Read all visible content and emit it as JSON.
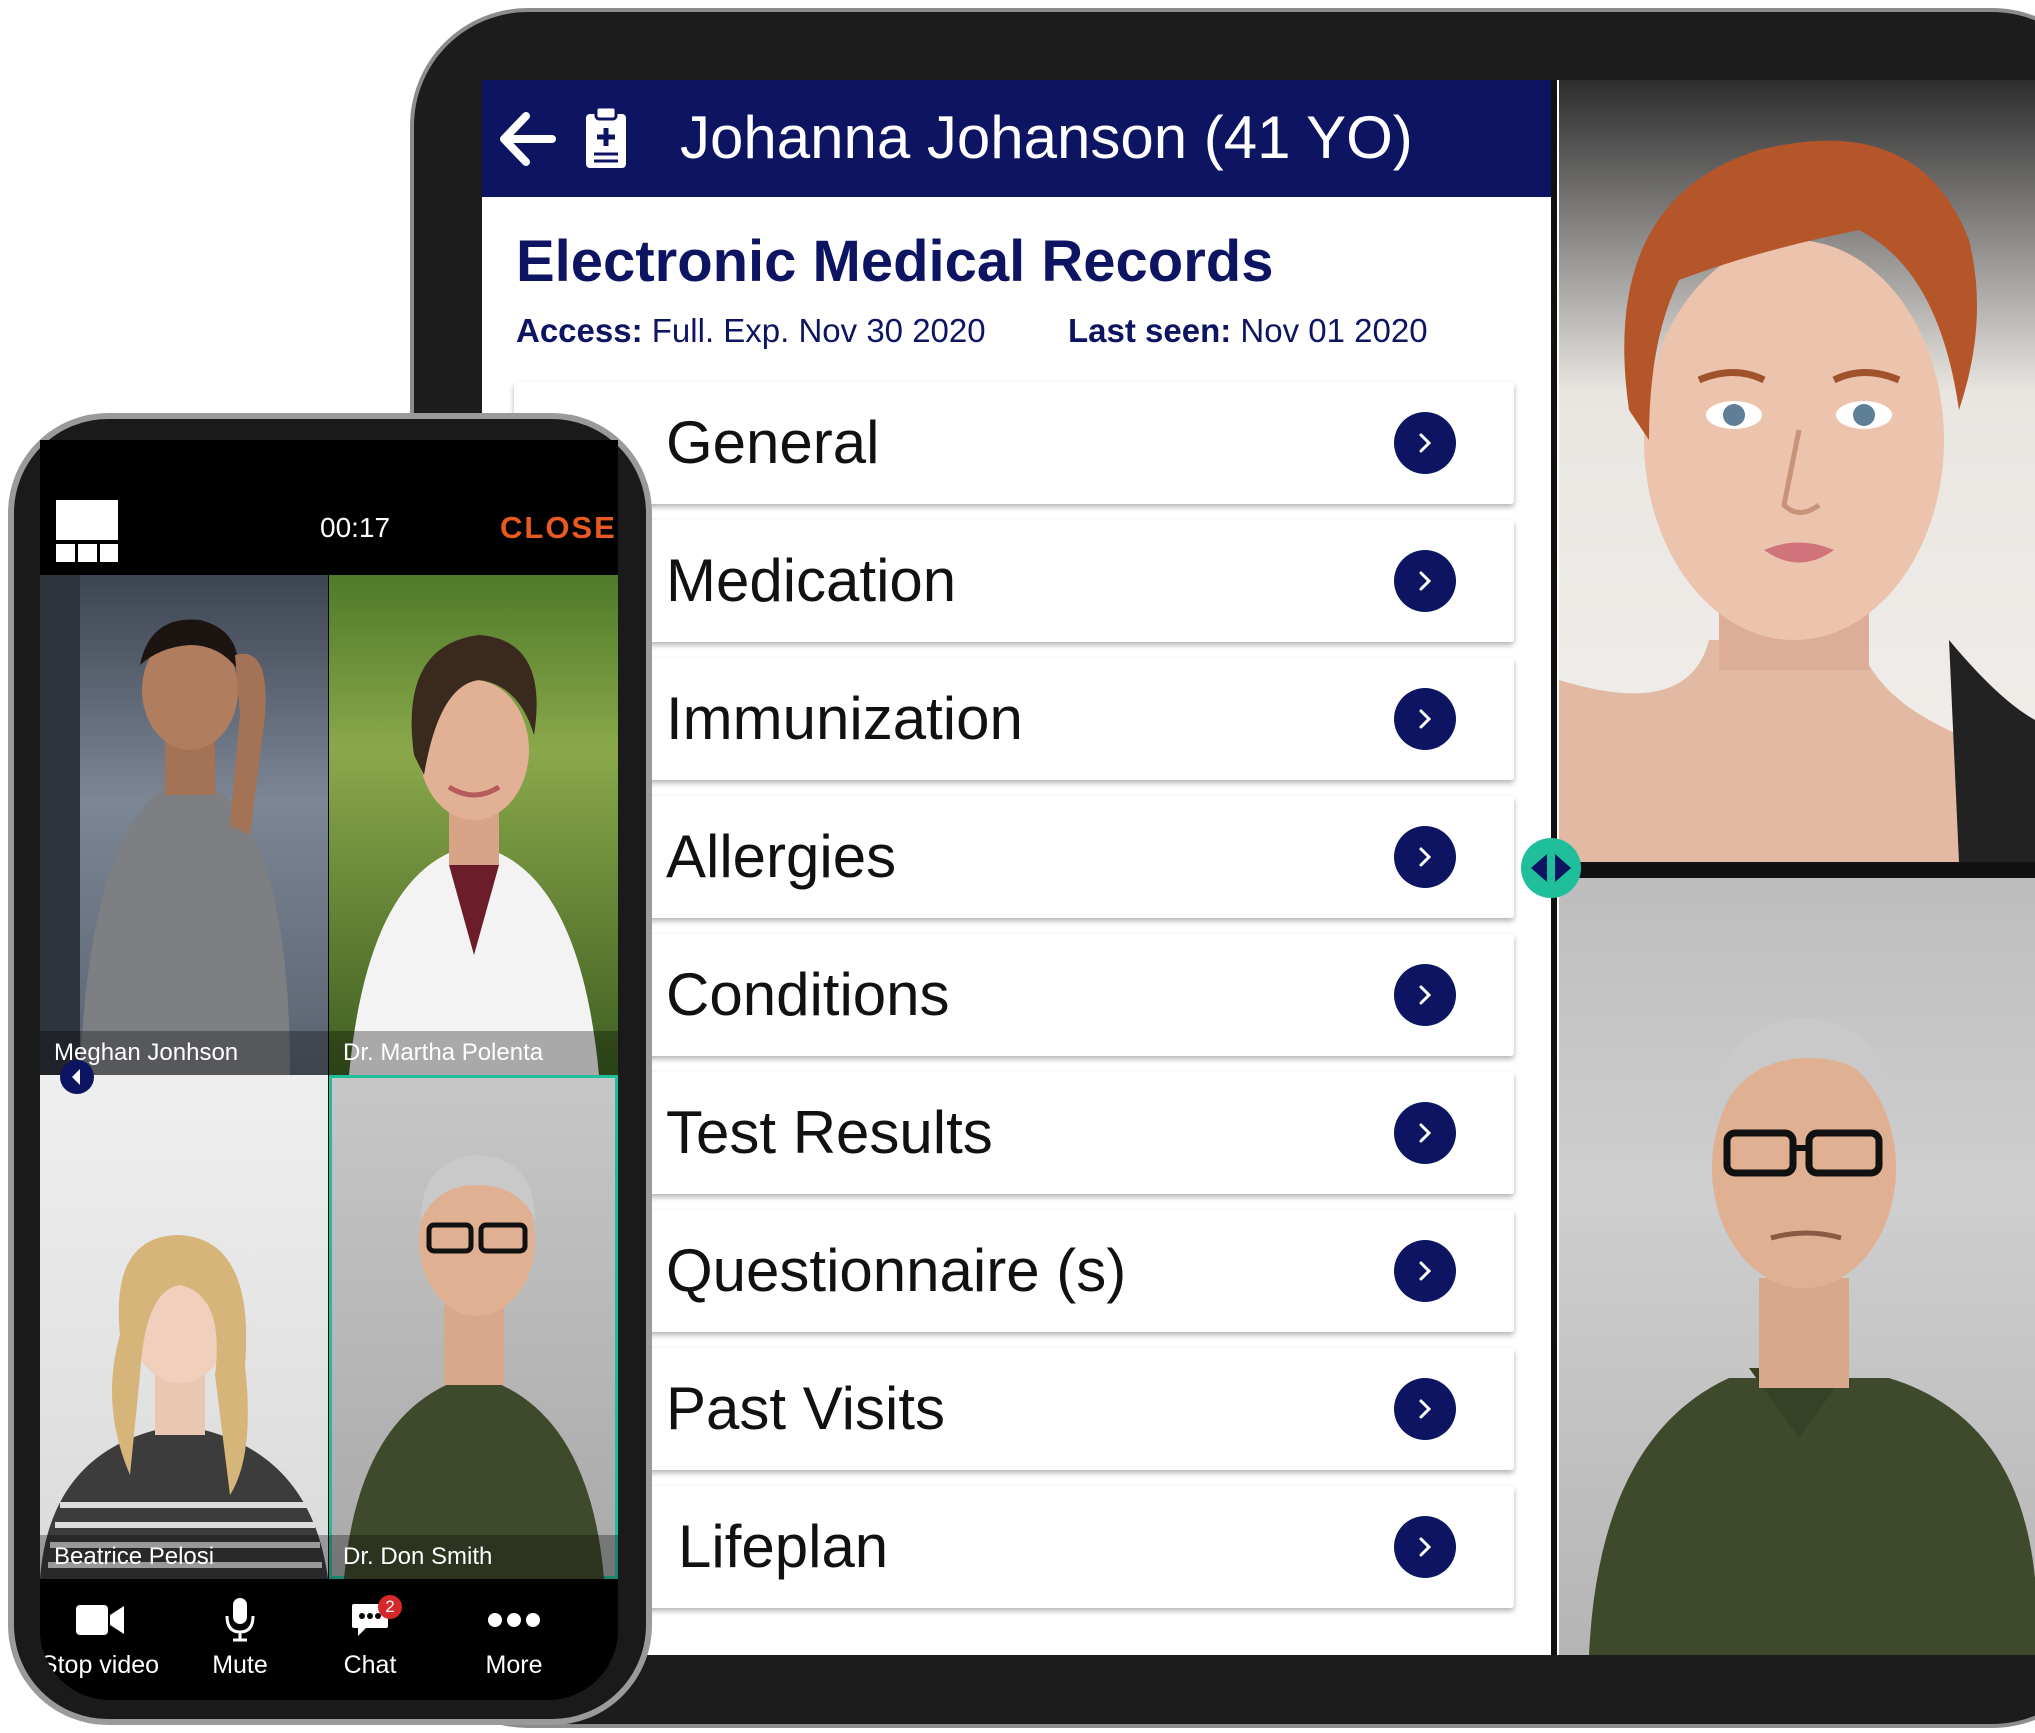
{
  "emr": {
    "patient_name": "Johanna Johanson (41 YO)",
    "title": "Electronic Medical Records",
    "access_label": "Access:",
    "access_value": "Full. Exp. Nov 30 2020",
    "last_seen_label": "Last seen:",
    "last_seen_value": "Nov 01 2020",
    "sections": [
      {
        "label": "General"
      },
      {
        "label": "Medication"
      },
      {
        "label": "Immunization"
      },
      {
        "label": "Allergies"
      },
      {
        "label": "Conditions"
      },
      {
        "label": "Test Results"
      },
      {
        "label": "Questionnaire (s)"
      },
      {
        "label": "Past Visits"
      },
      {
        "label": "Lifeplan"
      }
    ]
  },
  "call": {
    "timer": "00:17",
    "close_label": "CLOSE",
    "participants": [
      {
        "name": "Meghan  Jonhson"
      },
      {
        "name": "Dr. Martha Polenta"
      },
      {
        "name": "Beatrice Pelosi"
      },
      {
        "name": "Dr. Don Smith"
      }
    ],
    "toolbar": {
      "stop_video": "Stop video",
      "mute": "Mute",
      "chat": "Chat",
      "chat_badge": "2",
      "more": "More"
    }
  },
  "colors": {
    "navy": "#0d1563",
    "accent_teal": "#1fbf9b",
    "close_orange": "#e85a1f",
    "badge_red": "#d62828"
  },
  "icons": [
    "back-arrow-icon",
    "clipboard-icon",
    "chevron-right-icon",
    "grid-layout-icon",
    "video-camera-icon",
    "microphone-icon",
    "chat-bubble-icon",
    "more-dots-icon",
    "split-handle-icon"
  ]
}
